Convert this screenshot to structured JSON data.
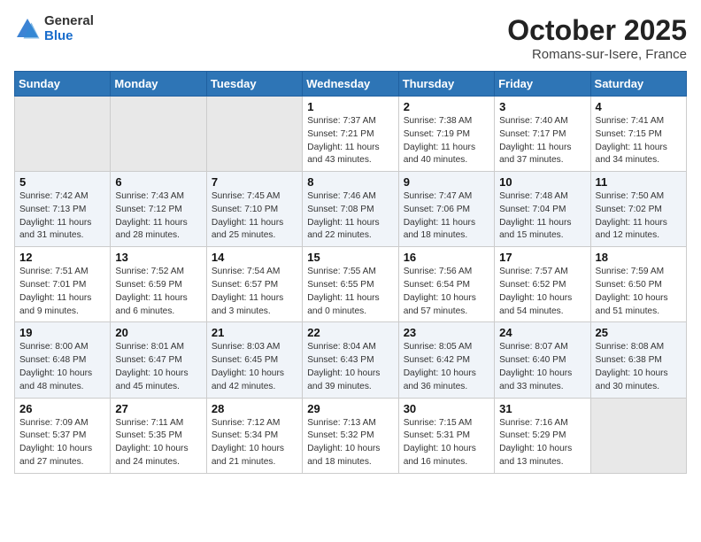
{
  "header": {
    "logo_general": "General",
    "logo_blue": "Blue",
    "month_title": "October 2025",
    "subtitle": "Romans-sur-Isere, France"
  },
  "calendar": {
    "days_of_week": [
      "Sunday",
      "Monday",
      "Tuesday",
      "Wednesday",
      "Thursday",
      "Friday",
      "Saturday"
    ],
    "weeks": [
      [
        {
          "day": "",
          "info": ""
        },
        {
          "day": "",
          "info": ""
        },
        {
          "day": "",
          "info": ""
        },
        {
          "day": "1",
          "info": "Sunrise: 7:37 AM\nSunset: 7:21 PM\nDaylight: 11 hours and 43 minutes."
        },
        {
          "day": "2",
          "info": "Sunrise: 7:38 AM\nSunset: 7:19 PM\nDaylight: 11 hours and 40 minutes."
        },
        {
          "day": "3",
          "info": "Sunrise: 7:40 AM\nSunset: 7:17 PM\nDaylight: 11 hours and 37 minutes."
        },
        {
          "day": "4",
          "info": "Sunrise: 7:41 AM\nSunset: 7:15 PM\nDaylight: 11 hours and 34 minutes."
        }
      ],
      [
        {
          "day": "5",
          "info": "Sunrise: 7:42 AM\nSunset: 7:13 PM\nDaylight: 11 hours and 31 minutes."
        },
        {
          "day": "6",
          "info": "Sunrise: 7:43 AM\nSunset: 7:12 PM\nDaylight: 11 hours and 28 minutes."
        },
        {
          "day": "7",
          "info": "Sunrise: 7:45 AM\nSunset: 7:10 PM\nDaylight: 11 hours and 25 minutes."
        },
        {
          "day": "8",
          "info": "Sunrise: 7:46 AM\nSunset: 7:08 PM\nDaylight: 11 hours and 22 minutes."
        },
        {
          "day": "9",
          "info": "Sunrise: 7:47 AM\nSunset: 7:06 PM\nDaylight: 11 hours and 18 minutes."
        },
        {
          "day": "10",
          "info": "Sunrise: 7:48 AM\nSunset: 7:04 PM\nDaylight: 11 hours and 15 minutes."
        },
        {
          "day": "11",
          "info": "Sunrise: 7:50 AM\nSunset: 7:02 PM\nDaylight: 11 hours and 12 minutes."
        }
      ],
      [
        {
          "day": "12",
          "info": "Sunrise: 7:51 AM\nSunset: 7:01 PM\nDaylight: 11 hours and 9 minutes."
        },
        {
          "day": "13",
          "info": "Sunrise: 7:52 AM\nSunset: 6:59 PM\nDaylight: 11 hours and 6 minutes."
        },
        {
          "day": "14",
          "info": "Sunrise: 7:54 AM\nSunset: 6:57 PM\nDaylight: 11 hours and 3 minutes."
        },
        {
          "day": "15",
          "info": "Sunrise: 7:55 AM\nSunset: 6:55 PM\nDaylight: 11 hours and 0 minutes."
        },
        {
          "day": "16",
          "info": "Sunrise: 7:56 AM\nSunset: 6:54 PM\nDaylight: 10 hours and 57 minutes."
        },
        {
          "day": "17",
          "info": "Sunrise: 7:57 AM\nSunset: 6:52 PM\nDaylight: 10 hours and 54 minutes."
        },
        {
          "day": "18",
          "info": "Sunrise: 7:59 AM\nSunset: 6:50 PM\nDaylight: 10 hours and 51 minutes."
        }
      ],
      [
        {
          "day": "19",
          "info": "Sunrise: 8:00 AM\nSunset: 6:48 PM\nDaylight: 10 hours and 48 minutes."
        },
        {
          "day": "20",
          "info": "Sunrise: 8:01 AM\nSunset: 6:47 PM\nDaylight: 10 hours and 45 minutes."
        },
        {
          "day": "21",
          "info": "Sunrise: 8:03 AM\nSunset: 6:45 PM\nDaylight: 10 hours and 42 minutes."
        },
        {
          "day": "22",
          "info": "Sunrise: 8:04 AM\nSunset: 6:43 PM\nDaylight: 10 hours and 39 minutes."
        },
        {
          "day": "23",
          "info": "Sunrise: 8:05 AM\nSunset: 6:42 PM\nDaylight: 10 hours and 36 minutes."
        },
        {
          "day": "24",
          "info": "Sunrise: 8:07 AM\nSunset: 6:40 PM\nDaylight: 10 hours and 33 minutes."
        },
        {
          "day": "25",
          "info": "Sunrise: 8:08 AM\nSunset: 6:38 PM\nDaylight: 10 hours and 30 minutes."
        }
      ],
      [
        {
          "day": "26",
          "info": "Sunrise: 7:09 AM\nSunset: 5:37 PM\nDaylight: 10 hours and 27 minutes."
        },
        {
          "day": "27",
          "info": "Sunrise: 7:11 AM\nSunset: 5:35 PM\nDaylight: 10 hours and 24 minutes."
        },
        {
          "day": "28",
          "info": "Sunrise: 7:12 AM\nSunset: 5:34 PM\nDaylight: 10 hours and 21 minutes."
        },
        {
          "day": "29",
          "info": "Sunrise: 7:13 AM\nSunset: 5:32 PM\nDaylight: 10 hours and 18 minutes."
        },
        {
          "day": "30",
          "info": "Sunrise: 7:15 AM\nSunset: 5:31 PM\nDaylight: 10 hours and 16 minutes."
        },
        {
          "day": "31",
          "info": "Sunrise: 7:16 AM\nSunset: 5:29 PM\nDaylight: 10 hours and 13 minutes."
        },
        {
          "day": "",
          "info": ""
        }
      ]
    ]
  }
}
